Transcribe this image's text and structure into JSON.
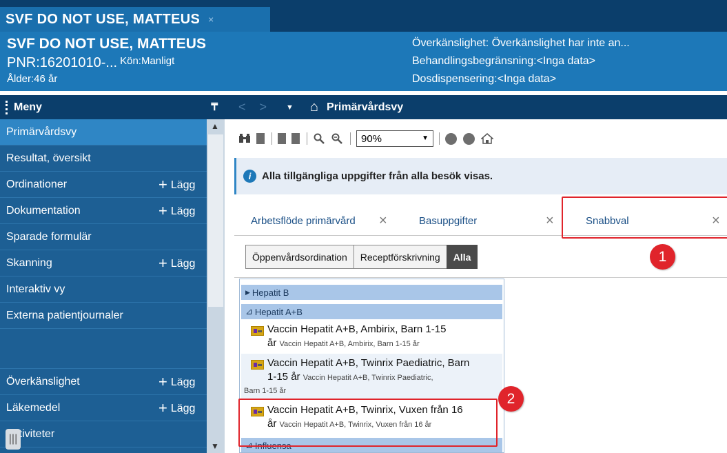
{
  "patient_tab": {
    "title": "SVF DO NOT USE, MATTEUS",
    "close": "×"
  },
  "banner": {
    "name": "SVF DO NOT USE, MATTEUS",
    "pnr": "PNR:16201010-...",
    "kon": "Kön:Manligt",
    "alder": "Ålder:46 år",
    "overkanslighet": "Överkänslighet: Överkänslighet har inte an...",
    "behandling": "Behandlingsbegränsning:<Inga data>",
    "dosdispensering": "Dosdispensering:<Inga data>"
  },
  "menu": {
    "title": "Meny",
    "pin": "₸",
    "items": [
      {
        "label": "Primärvårdsvy",
        "add": ""
      },
      {
        "label": "Resultat, översikt",
        "add": ""
      },
      {
        "label": "Ordinationer",
        "add": "Lägg"
      },
      {
        "label": "Dokumentation",
        "add": "Lägg"
      },
      {
        "label": "Sparade formulär",
        "add": ""
      },
      {
        "label": "Skanning",
        "add": "Lägg"
      },
      {
        "label": "Interaktiv vy",
        "add": ""
      },
      {
        "label": "Externa patientjournaler",
        "add": ""
      }
    ],
    "items2": [
      {
        "label": "Överkänslighet",
        "add": "Lägg"
      },
      {
        "label": "Läkemedel",
        "add": "Lägg"
      },
      {
        "label": "Aktiviteter",
        "add": ""
      }
    ],
    "add_symbol": "+",
    "grip": "|||"
  },
  "nav": {
    "back": "<",
    "forward": ">",
    "dropdown": "▼",
    "home_icon": "⌂",
    "title": "Primärvårdsvy"
  },
  "toolbar": {
    "zoom": "90%"
  },
  "info": {
    "text": "Alla tillgängliga uppgifter från alla besök visas."
  },
  "tabs": [
    {
      "label": "Arbetsflöde primärvård"
    },
    {
      "label": "Basuppgifter"
    },
    {
      "label": "Snabbval"
    }
  ],
  "filters": [
    {
      "label": "Öppenvårdsordination"
    },
    {
      "label": "Receptförskrivning"
    },
    {
      "label": "Alla"
    }
  ],
  "list": {
    "groups": [
      {
        "label": "Hepatit B",
        "expander": "▶"
      },
      {
        "label": "Hepatit A+B",
        "expander": "⊿"
      },
      {
        "label": "Influensa",
        "expander": "⊿"
      }
    ],
    "items": [
      {
        "line1": "Vaccin Hepatit A+B, Ambirix, Barn 1-15",
        "line2": "år",
        "sub": "Vaccin Hepatit A+B, Ambirix, Barn 1-15 år",
        "sub2": ""
      },
      {
        "line1": "Vaccin Hepatit A+B, Twinrix Paediatric, Barn",
        "line2": "1-15 år",
        "sub": "Vaccin Hepatit A+B, Twinrix Paediatric,",
        "sub2": "Barn 1-15 år"
      },
      {
        "line1": "Vaccin Hepatit A+B, Twinrix, Vuxen från 16",
        "line2": "år",
        "sub": "Vaccin Hepatit A+B, Twinrix, Vuxen från 16 år",
        "sub2": ""
      }
    ]
  },
  "badges": {
    "one": "1",
    "two": "2"
  },
  "colors": {
    "dark_navy": "#0b3e6b",
    "banner_blue": "#1d78b8",
    "menu_blue": "#1d5f94",
    "highlight_red": "#e0242b"
  }
}
